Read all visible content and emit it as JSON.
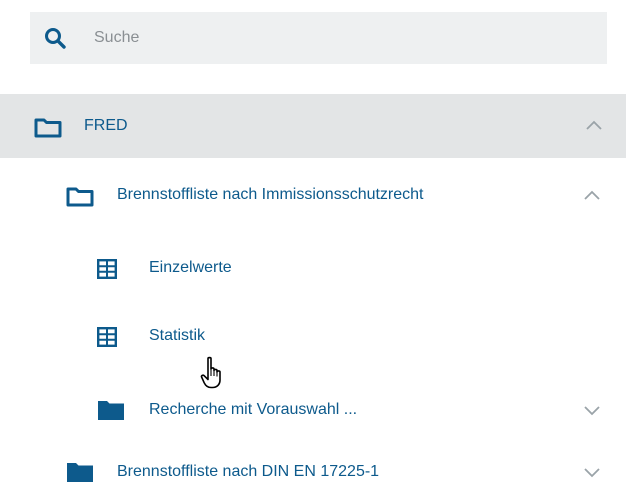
{
  "search": {
    "placeholder": "Suche",
    "value": ""
  },
  "tree": {
    "root": {
      "label": "FRED",
      "expanded": true,
      "icon": "folder-outline-icon"
    },
    "level1": [
      {
        "label": "Brennstoffliste nach Immissionsschutzrecht",
        "expanded": true,
        "icon": "folder-outline-icon",
        "children": [
          {
            "label": "Einzelwerte",
            "icon": "table-icon"
          },
          {
            "label": "Statistik",
            "icon": "table-icon"
          },
          {
            "label": "Recherche mit Vorauswahl ...",
            "icon": "folder-filled-icon",
            "expanded": false
          }
        ]
      },
      {
        "label": "Brennstoffliste nach DIN EN 17225-1",
        "expanded": false,
        "icon": "folder-filled-icon"
      }
    ]
  },
  "colors": {
    "accent": "#0d5a8c",
    "selected_row_bg": "#e3e5e6",
    "search_bg": "#eef0f1",
    "chevron": "#9aa3a8"
  }
}
